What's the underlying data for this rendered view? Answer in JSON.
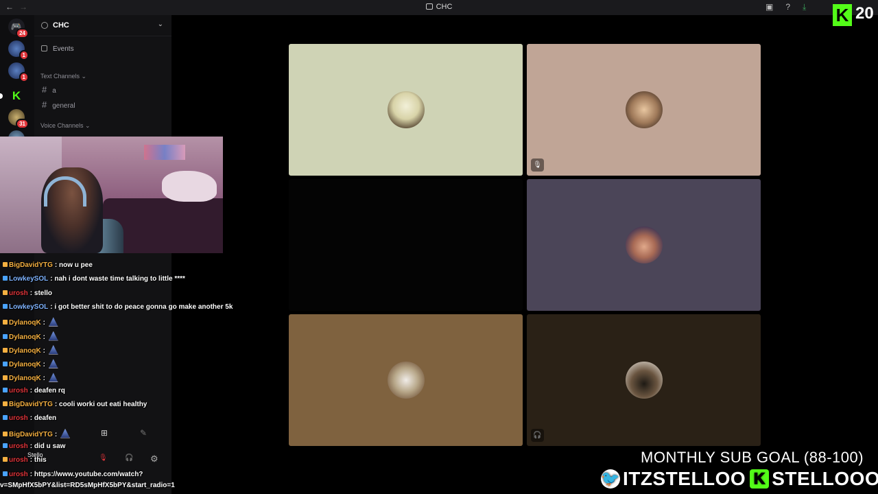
{
  "window": {
    "title": "CHC",
    "nav_back": "←",
    "nav_forward": "→",
    "tools": [
      "▣",
      "?",
      "⤓"
    ]
  },
  "rail": {
    "servers": [
      {
        "badge": "24"
      },
      {
        "badge": "1"
      },
      {
        "badge": "1"
      },
      {
        "badge": ""
      },
      {
        "badge": "31"
      },
      {
        "badge": ""
      }
    ],
    "kick_letter": "K"
  },
  "server": {
    "name": "CHC",
    "events_label": "Events",
    "text_category": "Text Channels",
    "text_channels": [
      "a",
      "general"
    ],
    "voice_category": "Voice Channels"
  },
  "voice_tiles": [
    {
      "bg": "#cfd3b5",
      "avatar": "hooded figure",
      "muted": false
    },
    {
      "bg": "#c0a596",
      "avatar": "cat",
      "muted": true
    },
    {
      "bg": "#040404",
      "avatar": "",
      "muted": false
    },
    {
      "bg": "#4b4558",
      "avatar": "face",
      "muted": false
    },
    {
      "bg": "#7f623f",
      "avatar": "basketball player",
      "muted": false
    },
    {
      "bg": "#2a2116",
      "avatar": "player walking",
      "muted": true
    }
  ],
  "chat": [
    {
      "user": "BigDavidYTG",
      "color": "#f5b041",
      "text": "now u pee",
      "emote": false
    },
    {
      "user": "LowkeySOL",
      "color": "#7fb3ff",
      "text": "nah i dont waste time talking to little ****",
      "emote": false
    },
    {
      "user": "urosh",
      "color": "#e1353b",
      "text": "stello",
      "emote": false
    },
    {
      "user": "LowkeySOL",
      "color": "#7fb3ff",
      "text": "i got better shit to do peace gonna go make another 5k",
      "emote": false
    },
    {
      "user": "DylanoqK",
      "color": "#f5b041",
      "text": "",
      "emote": true
    },
    {
      "user": "DylanoqK",
      "color": "#f5b041",
      "text": "",
      "emote": true
    },
    {
      "user": "DylanoqK",
      "color": "#f5b041",
      "text": "",
      "emote": true
    },
    {
      "user": "DylanoqK",
      "color": "#f5b041",
      "text": "",
      "emote": true
    },
    {
      "user": "DylanoqK",
      "color": "#f5b041",
      "text": "",
      "emote": true
    },
    {
      "user": "urosh",
      "color": "#e1353b",
      "text": "deafen rq",
      "emote": false
    },
    {
      "user": "BigDavidYTG",
      "color": "#f5b041",
      "text": "cooli worki out eati healthy",
      "emote": false
    },
    {
      "user": "urosh",
      "color": "#e1353b",
      "text": "deafen",
      "emote": false
    },
    {
      "user": "BigDavidYTG",
      "color": "#f5b041",
      "text": "",
      "emote": true
    },
    {
      "user": "urosh",
      "color": "#e1353b",
      "text": "did u saw",
      "emote": false
    },
    {
      "user": "urosh",
      "color": "#e1353b",
      "text": "this",
      "emote": false
    },
    {
      "user": "urosh",
      "color": "#e1353b",
      "text": "https://www.youtube.com/watch?",
      "emote": false
    }
  ],
  "url_tail": "v=SMpHfX5bPY&list=RD5sMpHfX5bPY&start_radio=1",
  "user_panel": {
    "name": "Stello"
  },
  "overlay": {
    "kick_logo": "K",
    "kick_number": "20",
    "sub_goal": "MONTHLY SUB GOAL (88-100)",
    "twitter_handle": "ITZSTELLOO",
    "kick_handle": "STELLOOO",
    "twitter_icon": "🐦",
    "kick_icon": "K"
  }
}
